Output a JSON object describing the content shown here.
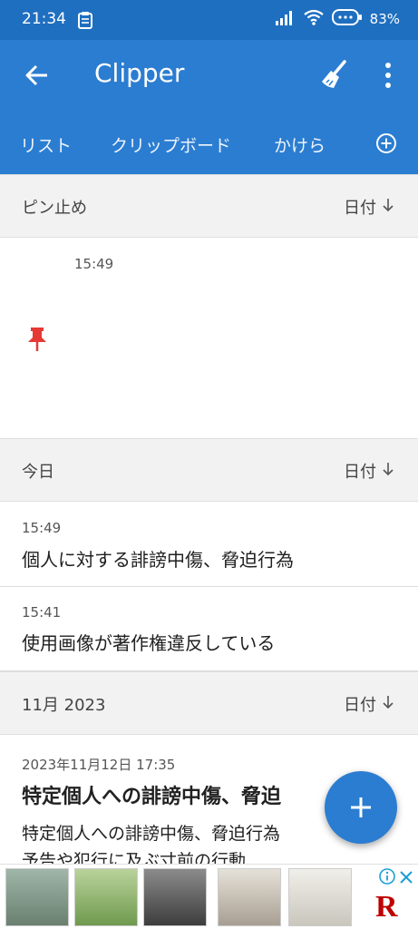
{
  "status_bar": {
    "time": "21:34",
    "battery": "83%",
    "icons": [
      "clipboard-icon",
      "signal-icon",
      "wifi-icon",
      "battery-icon"
    ]
  },
  "app_bar": {
    "title": "Clipper",
    "icons": [
      "back-arrow-icon",
      "broom-icon",
      "more-vert-icon"
    ]
  },
  "tabs": {
    "items": [
      {
        "label": "リスト"
      },
      {
        "label": "クリップボード"
      },
      {
        "label": "かけら"
      }
    ]
  },
  "sections": {
    "pinned": {
      "label": "ピン止め",
      "sort": "日付"
    },
    "today": {
      "label": "今日",
      "sort": "日付"
    },
    "nov": {
      "label": "11月 2023",
      "sort": "日付"
    }
  },
  "pinned_item": {
    "time": "15:49"
  },
  "today_items": [
    {
      "time": "15:49",
      "text": "個人に対する誹謗中傷、脅迫行為"
    },
    {
      "time": "15:41",
      "text": "使用画像が著作権違反している"
    }
  ],
  "nov_item": {
    "time": "2023年11月12日 17:35",
    "title": "特定個人への誹謗中傷、脅迫",
    "line1": "特定個人への誹謗中傷、脅迫行為",
    "line2": "予告や犯行に及ぶ寸前の行動"
  },
  "colors": {
    "status_bar": "#1f6fc0",
    "app_bar": "#2b7dd1",
    "section_bg": "#f2f2f2",
    "pin": "#e53935",
    "ad_logo": "#bf0000"
  },
  "ad": {
    "logo": "R"
  }
}
